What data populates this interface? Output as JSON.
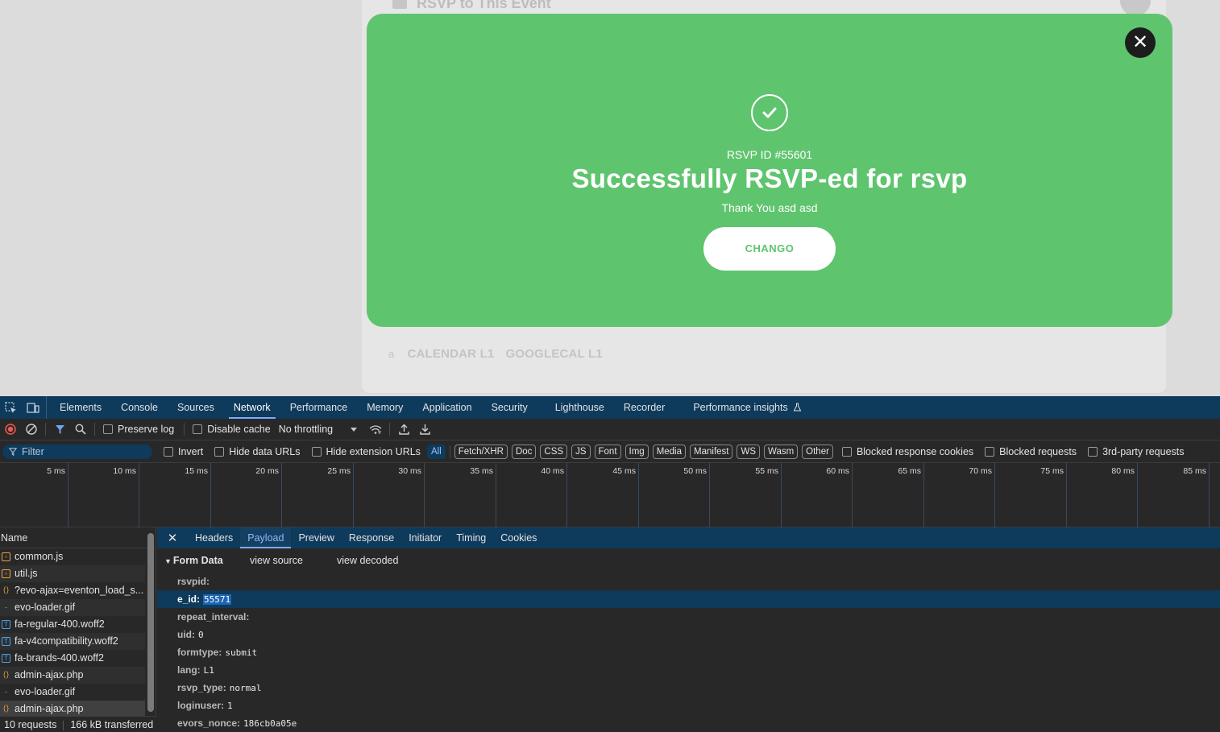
{
  "page": {
    "bg_title": "RSVP to This Event",
    "bg_links": [
      "CALENDAR L1",
      "GOOGLECAL L1"
    ]
  },
  "modal": {
    "rsvp_id": "RSVP ID #55601",
    "headline": "Successfully RSVP-ed for rsvp",
    "thanks": "Thank You asd asd",
    "button_label": "CHANGO",
    "close_glyph": "✕",
    "colors": {
      "background": "#5fc46e",
      "close": "#1d1d1d"
    }
  },
  "devtools": {
    "tabs": [
      "Elements",
      "Console",
      "Sources",
      "Network",
      "Performance",
      "Memory",
      "Application",
      "Security",
      "Lighthouse",
      "Recorder",
      "Performance insights"
    ],
    "active_tab": "Network",
    "toolbar": {
      "preserve_log": "Preserve log",
      "disable_cache": "Disable cache",
      "throttling": "No throttling"
    },
    "filter": {
      "placeholder": "Filter",
      "invert": "Invert",
      "hide_data_urls": "Hide data URLs",
      "hide_extension_urls": "Hide extension URLs",
      "types": [
        "All",
        "Fetch/XHR",
        "Doc",
        "CSS",
        "JS",
        "Font",
        "Img",
        "Media",
        "Manifest",
        "WS",
        "Wasm",
        "Other"
      ],
      "active_type": "All",
      "blocked_response_cookies": "Blocked response cookies",
      "blocked_requests": "Blocked requests",
      "third_party": "3rd-party requests"
    },
    "timeline_ticks": [
      "5 ms",
      "10 ms",
      "15 ms",
      "20 ms",
      "25 ms",
      "30 ms",
      "35 ms",
      "40 ms",
      "45 ms",
      "50 ms",
      "55 ms",
      "60 ms",
      "65 ms",
      "70 ms",
      "75 ms",
      "80 ms",
      "85 ms"
    ],
    "name_header": "Name",
    "requests": [
      {
        "name": "common.js",
        "type": "script"
      },
      {
        "name": "util.js",
        "type": "script"
      },
      {
        "name": "?evo-ajax=eventon_load_s...",
        "type": "xhr"
      },
      {
        "name": "evo-loader.gif",
        "type": "img"
      },
      {
        "name": "fa-regular-400.woff2",
        "type": "font"
      },
      {
        "name": "fa-v4compatibility.woff2",
        "type": "font"
      },
      {
        "name": "fa-brands-400.woff2",
        "type": "font"
      },
      {
        "name": "admin-ajax.php",
        "type": "xhr"
      },
      {
        "name": "evo-loader.gif",
        "type": "img"
      },
      {
        "name": "admin-ajax.php",
        "type": "xhr"
      }
    ],
    "status": {
      "requests": "10 requests",
      "transferred": "166 kB transferred"
    },
    "detail_tabs": [
      "Headers",
      "Payload",
      "Preview",
      "Response",
      "Initiator",
      "Timing",
      "Cookies"
    ],
    "active_detail_tab": "Payload",
    "form": {
      "title": "Form Data",
      "view_source": "view source",
      "view_decoded": "view decoded",
      "rows": [
        {
          "key": "rsvpid:",
          "value": ""
        },
        {
          "key": "e_id:",
          "value": "55571"
        },
        {
          "key": "repeat_interval:",
          "value": ""
        },
        {
          "key": "uid:",
          "value": "0"
        },
        {
          "key": "formtype:",
          "value": "submit"
        },
        {
          "key": "lang:",
          "value": "L1"
        },
        {
          "key": "rsvp_type:",
          "value": "normal"
        },
        {
          "key": "loginuser:",
          "value": "1"
        },
        {
          "key": "evors_nonce:",
          "value": "186cb0a05e"
        }
      ]
    }
  }
}
